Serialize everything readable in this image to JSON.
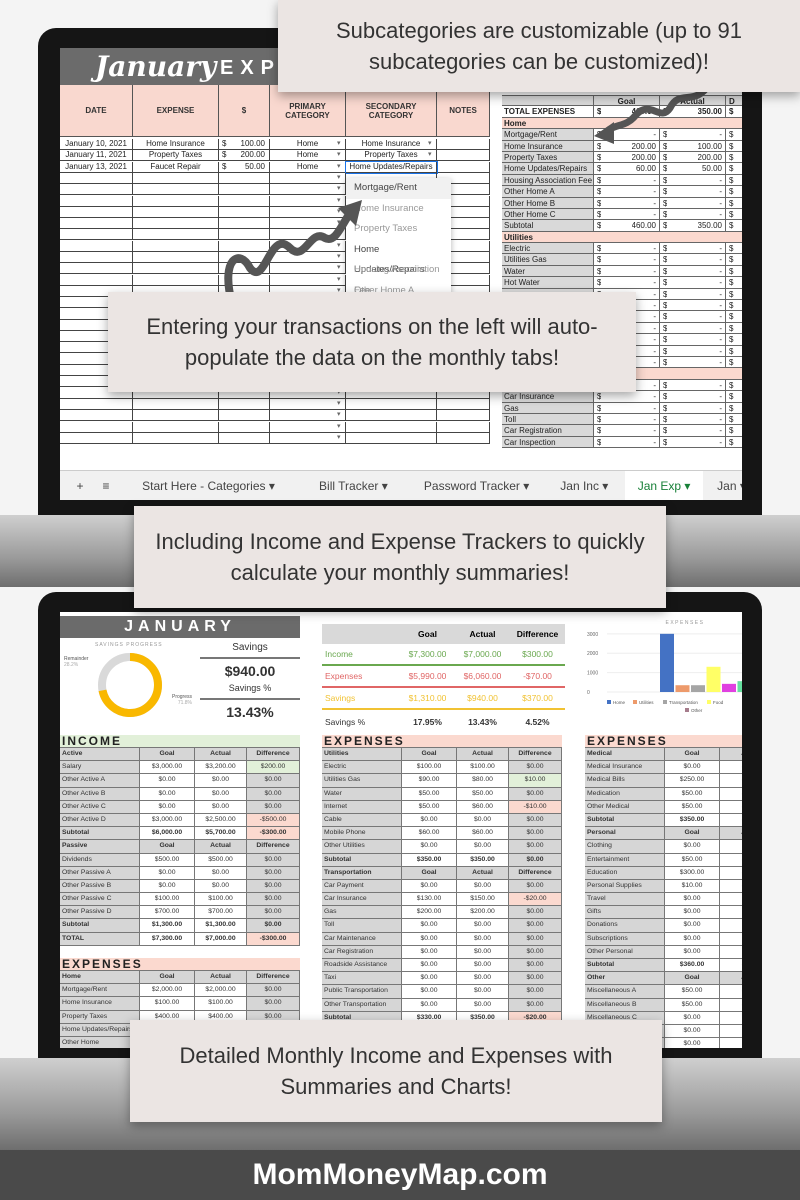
{
  "callouts": {
    "c1": "Subcategories are customizable (up to 91 subcategories can be customized)!",
    "c2": "Entering your transactions on the left will auto-populate the data on the monthly tabs!",
    "c3": "Including Income and Expense Trackers to quickly calculate your monthly summaries!",
    "c4": "Detailed Monthly Income and Expenses with Summaries and Charts!"
  },
  "footer": "MomMoneyMap.com",
  "top_sheet": {
    "title_script": "January",
    "title_spaced": "EXPEN",
    "headers": [
      "DATE",
      "EXPENSE",
      "$",
      "PRIMARY CATEGORY",
      "SECONDARY CATEGORY",
      "NOTES"
    ],
    "transactions": [
      [
        "January 10, 2021",
        "Home Insurance",
        "$",
        "100.00",
        "Home",
        "Home Insurance"
      ],
      [
        "January 11, 2021",
        "Property Taxes",
        "$",
        "200.00",
        "Home",
        "Property Taxes"
      ],
      [
        "January 13, 2021",
        "Faucet Repair",
        "$",
        "50.00",
        "Home",
        "Home Updates/Repairs"
      ]
    ],
    "dropdown_options": [
      "Mortgage/Rent",
      "Home Insurance",
      "Property Taxes",
      "Home Updates/Repairs",
      "Housing Association Fee",
      "Other Home A"
    ],
    "summary_headers": [
      "",
      "Goal",
      "Actual",
      "D"
    ],
    "summary_rows": [
      {
        "t": "total",
        "c": [
          "TOTAL EXPENSES",
          "460.00",
          "350.00"
        ]
      },
      {
        "t": "sec",
        "c": [
          "Home"
        ]
      },
      {
        "c": [
          "Mortgage/Rent",
          "-",
          "-"
        ]
      },
      {
        "c": [
          "Home Insurance",
          "200.00",
          "100.00"
        ]
      },
      {
        "c": [
          "Property Taxes",
          "200.00",
          "200.00"
        ]
      },
      {
        "c": [
          "Home Updates/Repairs",
          "60.00",
          "50.00"
        ]
      },
      {
        "c": [
          "Housing Association Fee",
          "-",
          "-"
        ]
      },
      {
        "c": [
          "Other Home A",
          "-",
          "-"
        ]
      },
      {
        "c": [
          "Other Home B",
          "-",
          "-"
        ]
      },
      {
        "c": [
          "Other Home C",
          "-",
          "-"
        ]
      },
      {
        "c": [
          "Subtotal",
          "460.00",
          "350.00"
        ]
      },
      {
        "t": "sec",
        "c": [
          "Utilities"
        ]
      },
      {
        "c": [
          "Electric",
          "-",
          "-"
        ]
      },
      {
        "c": [
          "Utilities Gas",
          "-",
          "-"
        ]
      },
      {
        "c": [
          "Water",
          "-",
          "-"
        ]
      },
      {
        "c": [
          "Hot Water",
          "-",
          "-"
        ]
      },
      {
        "c": [
          "",
          "-",
          "-"
        ]
      },
      {
        "c": [
          "",
          "-",
          "-"
        ]
      },
      {
        "c": [
          "",
          "-",
          "-"
        ]
      },
      {
        "c": [
          "",
          "-",
          "-"
        ]
      },
      {
        "c": [
          "",
          "-",
          "-"
        ]
      },
      {
        "c": [
          "",
          "-",
          "-"
        ]
      },
      {
        "c": [
          "",
          "-",
          "-"
        ]
      },
      {
        "t": "sec",
        "c": [
          ""
        ]
      },
      {
        "c": [
          "Car Payment",
          "-",
          "-"
        ]
      },
      {
        "c": [
          "Car Insurance",
          "-",
          "-"
        ]
      },
      {
        "c": [
          "Gas",
          "-",
          "-"
        ]
      },
      {
        "c": [
          "Toll",
          "-",
          "-"
        ]
      },
      {
        "c": [
          "Car Registration",
          "-",
          "-"
        ]
      },
      {
        "c": [
          "Car Inspection",
          "-",
          "-"
        ]
      }
    ],
    "tabs": [
      {
        "label": "+"
      },
      {
        "label": "≡"
      },
      {
        "label": "Start Here - Categories ▾"
      },
      {
        "label": "Bill Tracker ▾"
      },
      {
        "label": "Password Tracker ▾"
      },
      {
        "label": "Jan Inc ▾"
      },
      {
        "label": "Jan Exp ▾",
        "active": true
      },
      {
        "label": "Jan ▾"
      }
    ]
  },
  "dashboard": {
    "month": "JANUARY",
    "savings_progress": {
      "title": "SAVINGS PROGRESS",
      "remainder_label": "Remainder",
      "remainder_pct": "28.2%",
      "progress_label": "Progress",
      "progress_pct": "71.8%",
      "progress_value": 71.8,
      "color": "#f9b800"
    },
    "savings_label": "Savings",
    "savings_value": "$940.00",
    "savings_pct_label": "Savings %",
    "savings_pct_value": "13.43%",
    "summary": {
      "headers": [
        "",
        "Goal",
        "Actual",
        "Difference"
      ],
      "rows": [
        {
          "c": [
            "Income",
            "$7,300.00",
            "$7,000.00",
            "$300.00"
          ],
          "color": "#6aa84f"
        },
        {
          "c": [
            "Expenses",
            "$5,990.00",
            "$6,060.00",
            "-$70.00"
          ],
          "color": "#e06666"
        },
        {
          "c": [
            "Savings",
            "$1,310.00",
            "$940.00",
            "$370.00"
          ],
          "color": "#f1c232"
        },
        {
          "c": [
            "Savings %",
            "17.95%",
            "13.43%",
            "4.52%"
          ],
          "color": "#333333"
        }
      ]
    },
    "income": {
      "title": "INCOME",
      "rows": [
        {
          "t": "h",
          "c": [
            "Active",
            "Goal",
            "Actual",
            "Difference"
          ]
        },
        {
          "c": [
            "Salary",
            "$3,000.00",
            "$3,200.00",
            "$200.00"
          ],
          "d": "pos"
        },
        {
          "c": [
            "Other Active A",
            "$0.00",
            "$0.00",
            "$0.00"
          ]
        },
        {
          "c": [
            "Other Active B",
            "$0.00",
            "$0.00",
            "$0.00"
          ]
        },
        {
          "c": [
            "Other Active C",
            "$0.00",
            "$0.00",
            "$0.00"
          ]
        },
        {
          "c": [
            "Other Active D",
            "$3,000.00",
            "$2,500.00",
            "-$500.00"
          ],
          "d": "neg"
        },
        {
          "t": "s",
          "c": [
            "Subtotal",
            "$6,000.00",
            "$5,700.00",
            "-$300.00"
          ],
          "d": "neg"
        },
        {
          "t": "h",
          "c": [
            "Passive",
            "Goal",
            "Actual",
            "Difference"
          ]
        },
        {
          "c": [
            "Dividends",
            "$500.00",
            "$500.00",
            "$0.00"
          ]
        },
        {
          "c": [
            "Other Passive A",
            "$0.00",
            "$0.00",
            "$0.00"
          ]
        },
        {
          "c": [
            "Other Passive B",
            "$0.00",
            "$0.00",
            "$0.00"
          ]
        },
        {
          "c": [
            "Other Passive C",
            "$100.00",
            "$100.00",
            "$0.00"
          ]
        },
        {
          "c": [
            "Other Passive D",
            "$700.00",
            "$700.00",
            "$0.00"
          ]
        },
        {
          "t": "s",
          "c": [
            "Subtotal",
            "$1,300.00",
            "$1,300.00",
            "$0.00"
          ]
        },
        {
          "t": "s",
          "c": [
            "TOTAL",
            "$7,300.00",
            "$7,000.00",
            "-$300.00"
          ],
          "d": "neg"
        }
      ]
    },
    "expenses_home": {
      "title": "EXPENSES",
      "rows": [
        {
          "t": "h",
          "c": [
            "Home",
            "Goal",
            "Actual",
            "Difference"
          ]
        },
        {
          "c": [
            "Mortgage/Rent",
            "$2,000.00",
            "$2,000.00",
            "$0.00"
          ]
        },
        {
          "c": [
            "Home Insurance",
            "$100.00",
            "$100.00",
            "$0.00"
          ]
        },
        {
          "c": [
            "Property Taxes",
            "$400.00",
            "$400.00",
            "$0.00"
          ]
        },
        {
          "c": [
            "Home Updates/Repairs",
            "",
            "",
            ""
          ]
        },
        {
          "c": [
            "Other Home",
            "",
            "",
            ""
          ]
        }
      ]
    },
    "expenses_util": {
      "title": "EXPENSES",
      "rows": [
        {
          "t": "h",
          "c": [
            "Utilities",
            "Goal",
            "Actual",
            "Difference"
          ]
        },
        {
          "c": [
            "Electric",
            "$100.00",
            "$100.00",
            "$0.00"
          ]
        },
        {
          "c": [
            "Utilities Gas",
            "$90.00",
            "$80.00",
            "$10.00"
          ],
          "d": "pos"
        },
        {
          "c": [
            "Water",
            "$50.00",
            "$50.00",
            "$0.00"
          ]
        },
        {
          "c": [
            "Internet",
            "$50.00",
            "$60.00",
            "-$10.00"
          ],
          "d": "neg"
        },
        {
          "c": [
            "Cable",
            "$0.00",
            "$0.00",
            "$0.00"
          ]
        },
        {
          "c": [
            "Mobile Phone",
            "$60.00",
            "$60.00",
            "$0.00"
          ]
        },
        {
          "c": [
            "Other Utilities",
            "$0.00",
            "$0.00",
            "$0.00"
          ]
        },
        {
          "t": "s",
          "c": [
            "Subtotal",
            "$350.00",
            "$350.00",
            "$0.00"
          ]
        },
        {
          "t": "h",
          "c": [
            "Transportation",
            "Goal",
            "Actual",
            "Difference"
          ]
        },
        {
          "c": [
            "Car Payment",
            "$0.00",
            "$0.00",
            "$0.00"
          ]
        },
        {
          "c": [
            "Car Insurance",
            "$130.00",
            "$150.00",
            "-$20.00"
          ],
          "d": "neg"
        },
        {
          "c": [
            "Gas",
            "$200.00",
            "$200.00",
            "$0.00"
          ]
        },
        {
          "c": [
            "Toll",
            "$0.00",
            "$0.00",
            "$0.00"
          ]
        },
        {
          "c": [
            "Car Maintenance",
            "$0.00",
            "$0.00",
            "$0.00"
          ]
        },
        {
          "c": [
            "Car Registration",
            "$0.00",
            "$0.00",
            "$0.00"
          ]
        },
        {
          "c": [
            "Roadside Assistance",
            "$0.00",
            "$0.00",
            "$0.00"
          ]
        },
        {
          "c": [
            "Taxi",
            "$0.00",
            "$0.00",
            "$0.00"
          ]
        },
        {
          "c": [
            "Public Transportation",
            "$0.00",
            "$0.00",
            "$0.00"
          ]
        },
        {
          "c": [
            "Other Transportation",
            "$0.00",
            "$0.00",
            "$0.00"
          ]
        },
        {
          "t": "s",
          "c": [
            "Subtotal",
            "$330.00",
            "$350.00",
            "-$20.00"
          ],
          "d": "neg"
        }
      ]
    },
    "expenses_med": {
      "title": "EXPENSES",
      "rows": [
        {
          "t": "h",
          "c": [
            "Medical",
            "Goal",
            "Ac",
            ""
          ]
        },
        {
          "c": [
            "Medical Insurance",
            "$0.00",
            "$0",
            ""
          ]
        },
        {
          "c": [
            "Medical Bills",
            "$250.00",
            "$3",
            ""
          ]
        },
        {
          "c": [
            "Medication",
            "$50.00",
            "$5",
            ""
          ]
        },
        {
          "c": [
            "Other Medical",
            "$50.00",
            "$5",
            ""
          ]
        },
        {
          "t": "s",
          "c": [
            "Subtotal",
            "$350.00",
            "$4",
            ""
          ]
        },
        {
          "t": "h",
          "c": [
            "Personal",
            "Goal",
            "Ac",
            ""
          ]
        },
        {
          "c": [
            "Clothing",
            "$0.00",
            "$",
            ""
          ]
        },
        {
          "c": [
            "Entertainment",
            "$50.00",
            "$5",
            ""
          ]
        },
        {
          "c": [
            "Education",
            "$300.00",
            "$5",
            ""
          ]
        },
        {
          "c": [
            "Personal Supplies",
            "$10.00",
            "$2",
            ""
          ]
        },
        {
          "c": [
            "Travel",
            "$0.00",
            "$",
            ""
          ]
        },
        {
          "c": [
            "Gifts",
            "$0.00",
            "$",
            ""
          ]
        },
        {
          "c": [
            "Donations",
            "$0.00",
            "$",
            ""
          ]
        },
        {
          "c": [
            "Subscriptions",
            "$0.00",
            "$",
            ""
          ]
        },
        {
          "c": [
            "Other Personal",
            "$0.00",
            "$",
            ""
          ]
        },
        {
          "t": "s",
          "c": [
            "Subtotal",
            "$360.00",
            "$5",
            ""
          ]
        },
        {
          "t": "h",
          "c": [
            "Other",
            "Goal",
            "Ac",
            ""
          ]
        },
        {
          "c": [
            "Miscellaneous A",
            "$50.00",
            "$5",
            ""
          ]
        },
        {
          "c": [
            "Miscellaneous B",
            "$50.00",
            "$4",
            ""
          ]
        },
        {
          "c": [
            "Miscellaneous C",
            "$0.00",
            "$",
            ""
          ]
        },
        {
          "c": [
            "",
            "$0.00",
            "$",
            ""
          ]
        },
        {
          "c": [
            "",
            "$0.00",
            "$",
            ""
          ]
        }
      ]
    }
  },
  "chart_data": {
    "type": "bar",
    "title": "EXPENSES",
    "yticks": [
      "0",
      "1000",
      "2000",
      "3000"
    ],
    "ylim": [
      0,
      3300
    ],
    "grid": true,
    "legend": "bottom",
    "bars": [
      {
        "name": "Home",
        "value": 3000,
        "color": "#4472c4"
      },
      {
        "name": "Utilities",
        "value": 350,
        "color": "#ed9a6b"
      },
      {
        "name": "Transportation",
        "value": 350,
        "color": "#a5a5a5"
      },
      {
        "name": "Food",
        "value": 1300,
        "color": "#ffff66"
      },
      {
        "name": "",
        "value": 420,
        "color": "#e040e0"
      },
      {
        "name": "",
        "value": 560,
        "color": "#66e0a0"
      }
    ],
    "legend_entries": [
      {
        "name": "Home",
        "color": "#4472c4"
      },
      {
        "name": "Utilities",
        "color": "#ed9a6b"
      },
      {
        "name": "Transportation",
        "color": "#a5a5a5"
      },
      {
        "name": "Food",
        "color": "#ffff66"
      },
      {
        "name": "Other",
        "color": "#a67c8c"
      }
    ]
  }
}
